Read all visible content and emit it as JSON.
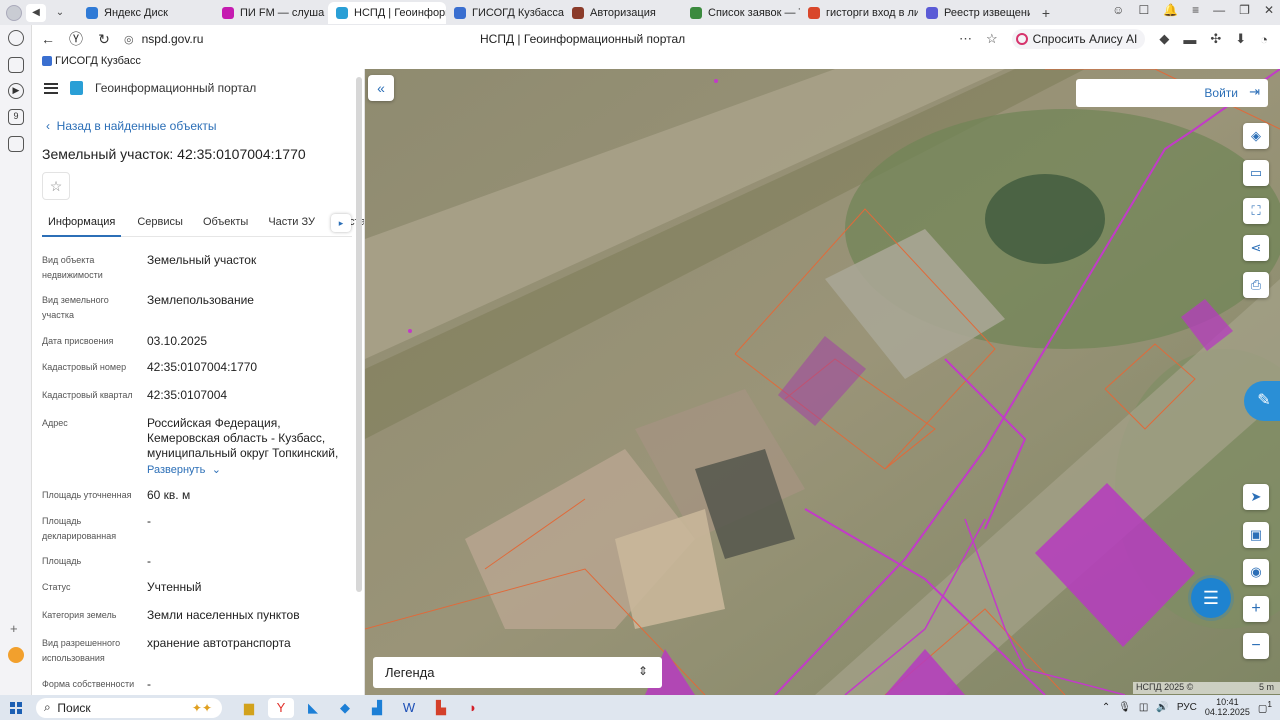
{
  "browser": {
    "tabs": [
      {
        "label": "Яндекс Диск",
        "color": "#2f7ad6"
      },
      {
        "label": "ПИ FM — слуша",
        "color": "#c51bb0"
      },
      {
        "label": "НСПД | Геоинформ",
        "color": "#2a9fd6",
        "active": true
      },
      {
        "label": "ГИСОГД Кузбасса",
        "color": "#3a6fd0"
      },
      {
        "label": "Авторизация",
        "color": "#8b3b2a"
      },
      {
        "label": "Список заявок — Тех",
        "color": "#3b8a3e"
      },
      {
        "label": "гисторги вход в личн",
        "color": "#d9472b"
      },
      {
        "label": "Реестр извещений",
        "color": "#5b5bd6"
      }
    ],
    "url": "nspd.gov.ru",
    "page_title": "НСПД | Геоинформационный портал",
    "alisa_label": "Спросить Алису AI",
    "bookmark": "ГИСОГД Кузбасс"
  },
  "panel": {
    "portal_name": "Геоинформационный портал",
    "back_link": "Назад в найденные объекты",
    "title": "Земельный участок: 42:35:0107004:1770",
    "tabs": [
      "Информация",
      "Сервисы",
      "Объекты",
      "Части ЗУ",
      "Соста"
    ],
    "rows": [
      {
        "key": "Вид объекта недвижимости",
        "value": "Земельный участок"
      },
      {
        "key": "Вид земельного участка",
        "value": "Землепользование"
      },
      {
        "key": "Дата присвоения",
        "value": "03.10.2025"
      },
      {
        "key": "Кадастровый номер",
        "value": "42:35:0107004:1770"
      },
      {
        "key": "Кадастровый квартал",
        "value": "42:35:0107004"
      },
      {
        "key": "Адрес",
        "value": "Российская Федерация, Кемеровская область - Кузбасс, муниципальный округ Топкинский,"
      },
      {
        "key": "Площадь уточненная",
        "value": "60 кв. м"
      },
      {
        "key": "Площадь декларированная",
        "value": "-"
      },
      {
        "key": "Площадь",
        "value": "-"
      },
      {
        "key": "Статус",
        "value": "Учтенный"
      },
      {
        "key": "Категория земель",
        "value": "Земли населенных пунктов"
      },
      {
        "key": "Вид разрешенного использования",
        "value": "хранение автотранспорта"
      },
      {
        "key": "Форма собственности",
        "value": "-"
      }
    ],
    "expand_label": "Развернуть"
  },
  "map": {
    "login_label": "Войти",
    "legend_label": "Легенда",
    "attribution": "НСПД 2025 ©",
    "scale": "5 m"
  },
  "taskbar": {
    "search_label": "Поиск",
    "lang": "РУС",
    "time": "10:41",
    "date": "04.12.2025",
    "notifications": "1"
  },
  "colors": {
    "accent": "#2c6fb7",
    "parcel_outline": "#e06a3a",
    "highlight_magenta": "#b63bbf"
  }
}
